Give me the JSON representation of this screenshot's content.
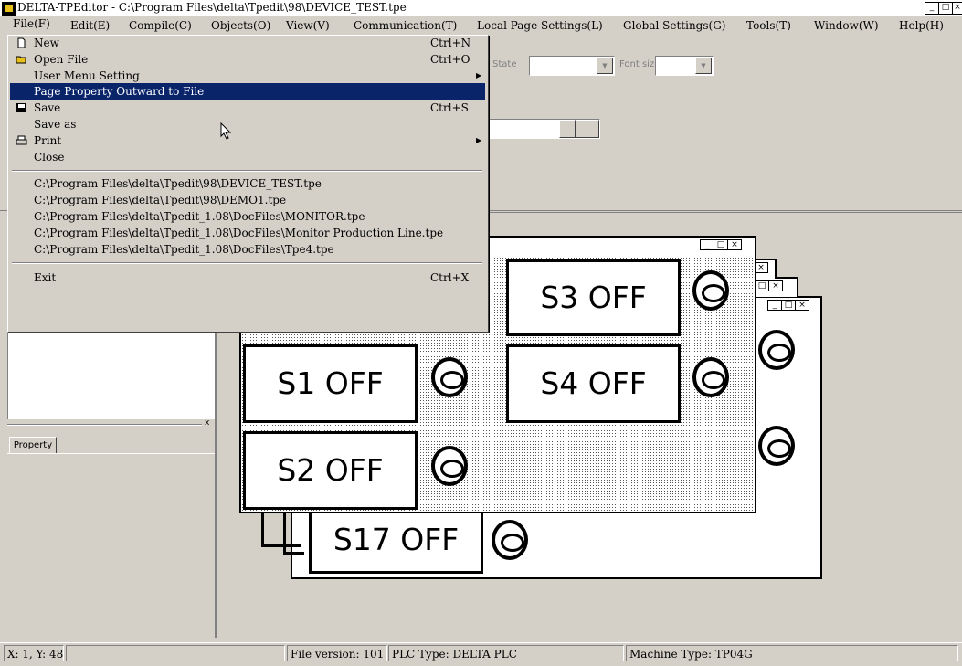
{
  "window": {
    "title": "DELTA-TPEditor - C:\\Program Files\\delta\\Tpedit\\98\\DEVICE_TEST.tpe",
    "controls": [
      "_",
      "□",
      "×"
    ]
  },
  "menubar": {
    "items": [
      "File(F)",
      "Edit(E)",
      "Compile(C)",
      "Objects(O)",
      "View(V)",
      "Communication(T)",
      "Local Page Settings(L)",
      "Global Settings(G)",
      "Tools(T)",
      "Window(W)",
      "Help(H)"
    ]
  },
  "file_menu": {
    "items": [
      {
        "label": "New",
        "shortcut": "Ctrl+N",
        "icon": "new-file-icon"
      },
      {
        "label": "Open File",
        "shortcut": "Ctrl+O",
        "icon": "folder-open-icon"
      },
      {
        "label": "User Menu Setting",
        "shortcut": "",
        "submenu": true
      },
      {
        "label": "Page Property Outward to File",
        "shortcut": "",
        "highlighted": true
      },
      {
        "label": "Save",
        "shortcut": "Ctrl+S",
        "icon": "floppy-disk-icon"
      },
      {
        "label": "Save as",
        "shortcut": ""
      },
      {
        "label": "Print",
        "shortcut": "",
        "submenu": true,
        "icon": "printer-icon"
      },
      {
        "label": "Close",
        "shortcut": ""
      }
    ],
    "recent": [
      "C:\\Program Files\\delta\\Tpedit\\98\\DEVICE_TEST.tpe",
      "C:\\Program Files\\delta\\Tpedit\\98\\DEMO1.tpe",
      "C:\\Program Files\\delta\\Tpedit_1.08\\DocFiles\\MONITOR.tpe",
      "C:\\Program Files\\delta\\Tpedit_1.08\\DocFiles\\Monitor Production Line.tpe",
      "C:\\Program Files\\delta\\Tpedit_1.08\\DocFiles\\Tpe4.tpe"
    ],
    "exit": {
      "label": "Exit",
      "shortcut": "Ctrl+X"
    }
  },
  "toolbar": {
    "state_label": "State",
    "font_size_label": "Font size"
  },
  "property_panel": {
    "tab_label": "Property",
    "close": "x"
  },
  "screens": {
    "front": {
      "buttons": [
        "S3 OFF",
        "S1 OFF",
        "S4 OFF",
        "S2 OFF"
      ]
    },
    "back": {
      "button": "S17 OFF"
    }
  },
  "statusbar": {
    "position": "X: 1, Y: 48",
    "file_version": "File version: 101",
    "plc_type": "PLC Type: DELTA PLC",
    "machine_type": "Machine Type: TP04G"
  },
  "colors": {
    "highlight": "#0a246a",
    "face": "#d4d0c8"
  }
}
